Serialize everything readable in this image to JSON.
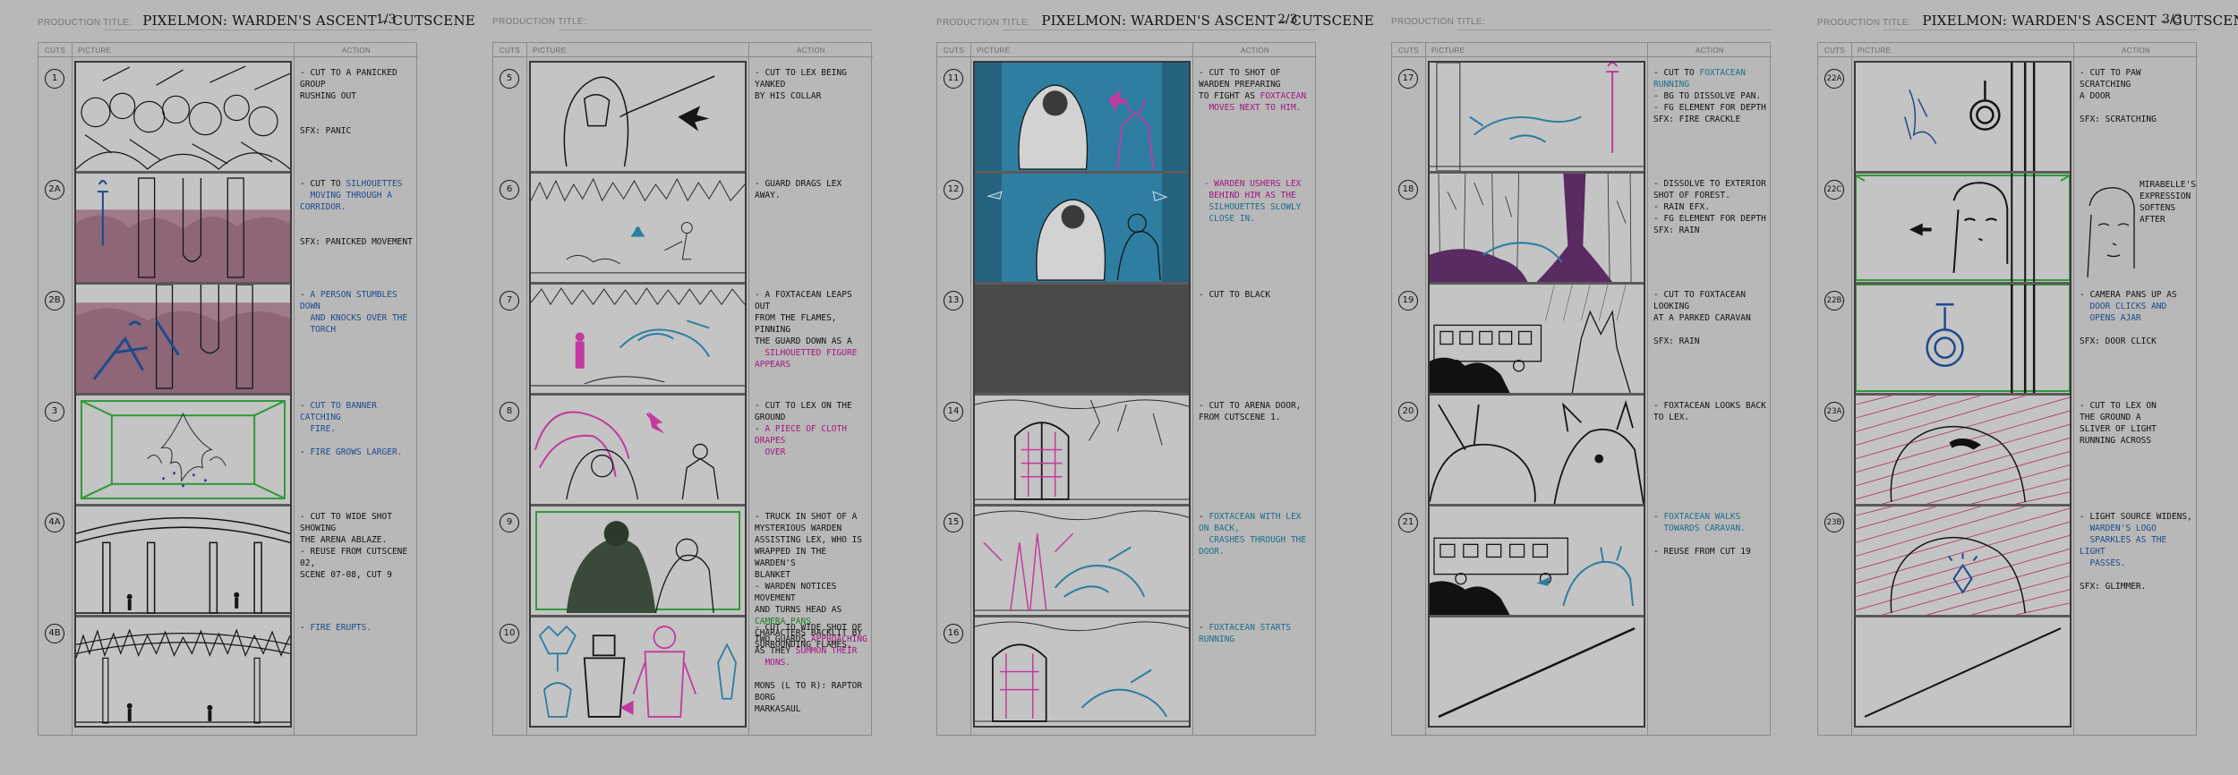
{
  "labels": {
    "production_title": "PRODUCTION TITLE:",
    "cuts": "CUTS",
    "picture": "PICTURE",
    "action": "ACTION"
  },
  "sheets": [
    {
      "title": "PIXELMON: WARDEN'S ASCENT – CUTSCENE",
      "page": "1/3",
      "cuts": [
        "1",
        "2A",
        "2B",
        "3",
        "4A",
        "4B"
      ],
      "actions": [
        [
          {
            "t": "- CUT TO A PANICKED GROUP"
          },
          {
            "t": "  RUSHING OUT"
          },
          {
            "t": ""
          },
          {
            "t": ""
          },
          {
            "t": "SFX: PANIC"
          }
        ],
        [
          {
            "t": "- CUT TO ",
            "c2": "SILHOUETTES"
          },
          {
            "t": "",
            "c2": "  MOVING THROUGH A CORRIDOR."
          },
          {
            "t": ""
          },
          {
            "t": ""
          },
          {
            "t": "SFX: PANICKED MOVEMENT"
          }
        ],
        [
          {
            "t": "- ",
            "c2": "A PERSON STUMBLES DOWN"
          },
          {
            "t": "",
            "c2": "  AND KNOCKS OVER THE"
          },
          {
            "t": "",
            "c2": "  TORCH"
          }
        ],
        [
          {
            "t": "- ",
            "c2": "CUT TO BANNER CATCHING"
          },
          {
            "t": "",
            "c2": "  FIRE."
          },
          {
            "t": ""
          },
          {
            "t": "- ",
            "c2": "FIRE GROWS LARGER."
          }
        ],
        [
          {
            "t": "- CUT TO WIDE SHOT SHOWING"
          },
          {
            "t": "  THE ARENA ABLAZE."
          },
          {
            "t": "- REUSE FROM CUTSCENE 02,"
          },
          {
            "t": "  SCENE 07-08, CUT 9"
          }
        ],
        [
          {
            "t": "- ",
            "c2": "FIRE ERUPTS."
          }
        ]
      ]
    },
    {
      "title": "",
      "page": "",
      "cuts": [
        "5",
        "6",
        "7",
        "8",
        "9",
        "10"
      ],
      "actions": [
        [
          {
            "t": "- CUT TO LEX BEING YANKED"
          },
          {
            "t": "  BY HIS COLLAR"
          }
        ],
        [
          {
            "t": "- GUARD DRAGS LEX AWAY."
          }
        ],
        [
          {
            "t": "- A FOXTACEAN LEAPS OUT"
          },
          {
            "t": "  FROM THE FLAMES, PINNING"
          },
          {
            "t": "  THE GUARD DOWN AS A"
          },
          {
            "t": "",
            "c3": "  SILHOUETTED FIGURE APPEARS"
          }
        ],
        [
          {
            "t": "- CUT TO LEX ON THE"
          },
          {
            "t": "  GROUND"
          },
          {
            "t": "- ",
            "c3": "A PIECE OF CLOTH DRAPES"
          },
          {
            "t": "",
            "c3": "  OVER"
          }
        ],
        [
          {
            "t": "- TRUCK IN SHOT OF A"
          },
          {
            "t": "  MYSTERIOUS WARDEN"
          },
          {
            "t": "  ASSISTING LEX, WHO IS"
          },
          {
            "t": "  WRAPPED IN THE WARDEN'S"
          },
          {
            "t": "  BLANKET"
          },
          {
            "t": "- WARDEN NOTICES MOVEMENT"
          },
          {
            "t": "  AND TURNS HEAD AS ",
            "c5": "CAMERA PANS"
          },
          {
            "t": "  CHARACTERS BACKLIT BY"
          },
          {
            "t": "  SURROUNDING FLAMES."
          }
        ],
        [
          {
            "t": "- CUT TO WIDE SHOT OF"
          },
          {
            "t": "  TWO GUARDS ",
            "c3": "APPROACHING"
          },
          {
            "t": "  AS THEY ",
            "c3": "SUMMON THEIR"
          },
          {
            "t": "",
            "c3": "  MONS."
          },
          {
            "t": ""
          },
          {
            "t": "MONS (L TO R): RAPTOR"
          },
          {
            "t": "               BORG"
          },
          {
            "t": "               MARKASAUL"
          }
        ]
      ]
    },
    {
      "title": "PIXELMON: WARDEN'S ASCENT – CUTSCENE",
      "page": "2/3",
      "cuts": [
        "11",
        "12",
        "13",
        "14",
        "15",
        "16"
      ],
      "actions": [
        [
          {
            "t": "- CUT TO SHOT OF"
          },
          {
            "t": "  WARDEN PREPARING"
          },
          {
            "t": "  TO FIGHT AS ",
            "c3": "FOXTACEAN"
          },
          {
            "t": "",
            "c3": "  MOVES NEXT TO HIM."
          }
        ],
        [
          {
            "t": "",
            "c3": "- WARDEN USHERS LEX"
          },
          {
            "t": "",
            "c3": "  BEHIND HIM AS THE"
          },
          {
            "t": "",
            "c4": "  SILHOUETTES SLOWLY"
          },
          {
            "t": "",
            "c4": "  CLOSE IN."
          }
        ],
        [
          {
            "t": "- CUT TO BLACK"
          }
        ],
        [
          {
            "t": "- CUT TO ARENA DOOR,"
          },
          {
            "t": "  FROM CUTSCENE 1."
          }
        ],
        [
          {
            "t": "- ",
            "c4": "FOXTACEAN WITH LEX ON BACK,"
          },
          {
            "t": "",
            "c4": "  CRASHES THROUGH THE DOOR."
          }
        ],
        [
          {
            "t": "- ",
            "c4": "FOXTACEAN STARTS RUNNING"
          }
        ]
      ]
    },
    {
      "title": "",
      "page": "",
      "cuts": [
        "17",
        "18",
        "19",
        "20",
        "21"
      ],
      "actions": [
        [
          {
            "t": "- CUT TO ",
            "c4": "FOXTACEAN RUNNING"
          },
          {
            "t": "- BG TO DISSOLVE PAN."
          },
          {
            "t": "- FG ELEMENT FOR DEPTH"
          },
          {
            "t": "SFX: FIRE CRACKLE"
          }
        ],
        [
          {
            "t": "- DISSOLVE TO EXTERIOR"
          },
          {
            "t": "  SHOT OF FOREST."
          },
          {
            "t": "- RAIN EFX."
          },
          {
            "t": "- FG ELEMENT FOR DEPTH"
          },
          {
            "t": "SFX: RAIN"
          }
        ],
        [
          {
            "t": "- CUT TO FOXTACEAN LOOKING"
          },
          {
            "t": "  AT A PARKED CARAVAN"
          },
          {
            "t": ""
          },
          {
            "t": "SFX: RAIN"
          }
        ],
        [
          {
            "t": "- FOXTACEAN LOOKS BACK"
          },
          {
            "t": "  TO LEX."
          }
        ],
        [
          {
            "t": "- ",
            "c4": "FOXTACEAN WALKS"
          },
          {
            "t": "",
            "c4": "  TOWARDS CARAVAN."
          },
          {
            "t": ""
          },
          {
            "t": "- REUSE FROM CUT 19"
          }
        ]
      ]
    },
    {
      "title": "PIXELMON: WARDEN'S ASCENT – CUTSCENE",
      "page": "3/3",
      "cuts": [
        "22A",
        "22C",
        "22B",
        "23A",
        "23B"
      ],
      "actions": [
        [
          {
            "t": "- CUT TO PAW SCRATCHING"
          },
          {
            "t": "  A DOOR"
          },
          {
            "t": ""
          },
          {
            "t": "SFX: SCRATCHING"
          }
        ],
        [],
        [
          {
            "t": "- CAMERA PANS UP AS"
          },
          {
            "t": "",
            "c2": "  DOOR CLICKS AND"
          },
          {
            "t": "",
            "c2": "  OPENS AJAR"
          },
          {
            "t": ""
          },
          {
            "t": "SFX: DOOR CLICK"
          }
        ],
        [
          {
            "t": "- CUT TO LEX ON"
          },
          {
            "t": "  THE GROUND A"
          },
          {
            "t": "  SLIVER OF LIGHT"
          },
          {
            "t": "  RUNNING ACROSS"
          }
        ],
        [
          {
            "t": "- LIGHT SOURCE WIDENS,"
          },
          {
            "t": "",
            "c2": "  WARDEN'S LOGO"
          },
          {
            "t": "",
            "c2": "  SPARKLES AS THE LIGHT"
          },
          {
            "t": "",
            "c2": "  PASSES."
          },
          {
            "t": ""
          },
          {
            "t": "SFX: GLIMMER."
          }
        ]
      ],
      "side_note": [
        "MIRABELLE'S",
        "EXPRESSION",
        "SOFTENS",
        "AFTER"
      ]
    }
  ],
  "colors": {
    "background": "#b8b8b8",
    "panel_fill": "#c4c4c4",
    "navy_note": "#1d4a8c",
    "magenta_note": "#a3157f",
    "teal_note": "#1c6d8c",
    "green_note": "#1e7a2a",
    "sky_blue": "#2e7ea2",
    "fire_mauve": "#a07a8a",
    "dark_purple": "#5a2a62",
    "pink_hatch": "#b43a6a",
    "green_frame": "#2f9a3a",
    "black_panel": "#4a4a4a"
  }
}
